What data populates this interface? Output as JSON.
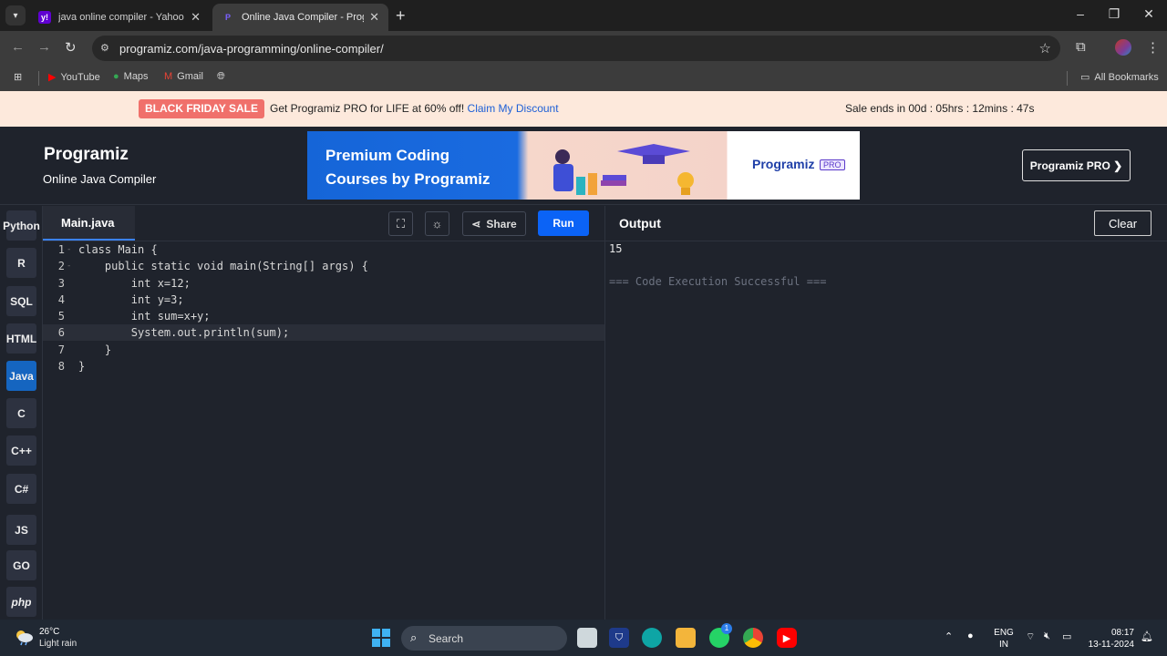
{
  "browser": {
    "tabs": [
      {
        "title": "java online compiler - Yahoo Inc",
        "favicon": "y!"
      },
      {
        "title": "Online Java Compiler - Programiz",
        "favicon": "P"
      }
    ],
    "url": "programiz.com/java-programming/online-compiler/",
    "bookmarks": [
      "YouTube",
      "Maps",
      "Gmail"
    ],
    "all_bookmarks": "All Bookmarks"
  },
  "sale": {
    "badge": "BLACK FRIDAY SALE",
    "text": "Get Programiz PRO for LIFE at 60% off!",
    "link": "Claim My Discount",
    "timer": "Sale ends in 00d : 05hrs : 12mins : 47s"
  },
  "header": {
    "logo": "Programiz",
    "subtitle": "Online Java Compiler",
    "ad_title": "Premium Coding Courses by Programiz",
    "ad_logo": "Programiz",
    "ad_pro": "PRO",
    "pro_button": "Programiz PRO ❯"
  },
  "sidebar": {
    "languages": [
      "Python",
      "R",
      "SQL",
      "HTML",
      "Java",
      "C",
      "C++",
      "C#",
      "JS",
      "GO",
      "php"
    ]
  },
  "editor": {
    "file_name": "Main.java",
    "share_label": "Share",
    "run_label": "Run",
    "line_numbers": [
      "1",
      "2",
      "3",
      "4",
      "5",
      "6",
      "7",
      "8"
    ],
    "lines": [
      "class Main {",
      "    public static void main(String[] args) {",
      "        int x=12;",
      "        int y=3;",
      "        int sum=x+y;",
      "        System.out.println(sum);",
      "    }",
      "}"
    ]
  },
  "output": {
    "title": "Output",
    "clear_label": "Clear",
    "lines": [
      "15",
      "",
      "=== Code Execution Successful ==="
    ]
  },
  "taskbar": {
    "temperature": "26°C",
    "weather": "Light rain",
    "search_label": "Search",
    "lang_top": "ENG",
    "lang_bottom": "IN",
    "time": "08:17",
    "date": "13-11-2024",
    "whatsapp_badge": "1"
  }
}
